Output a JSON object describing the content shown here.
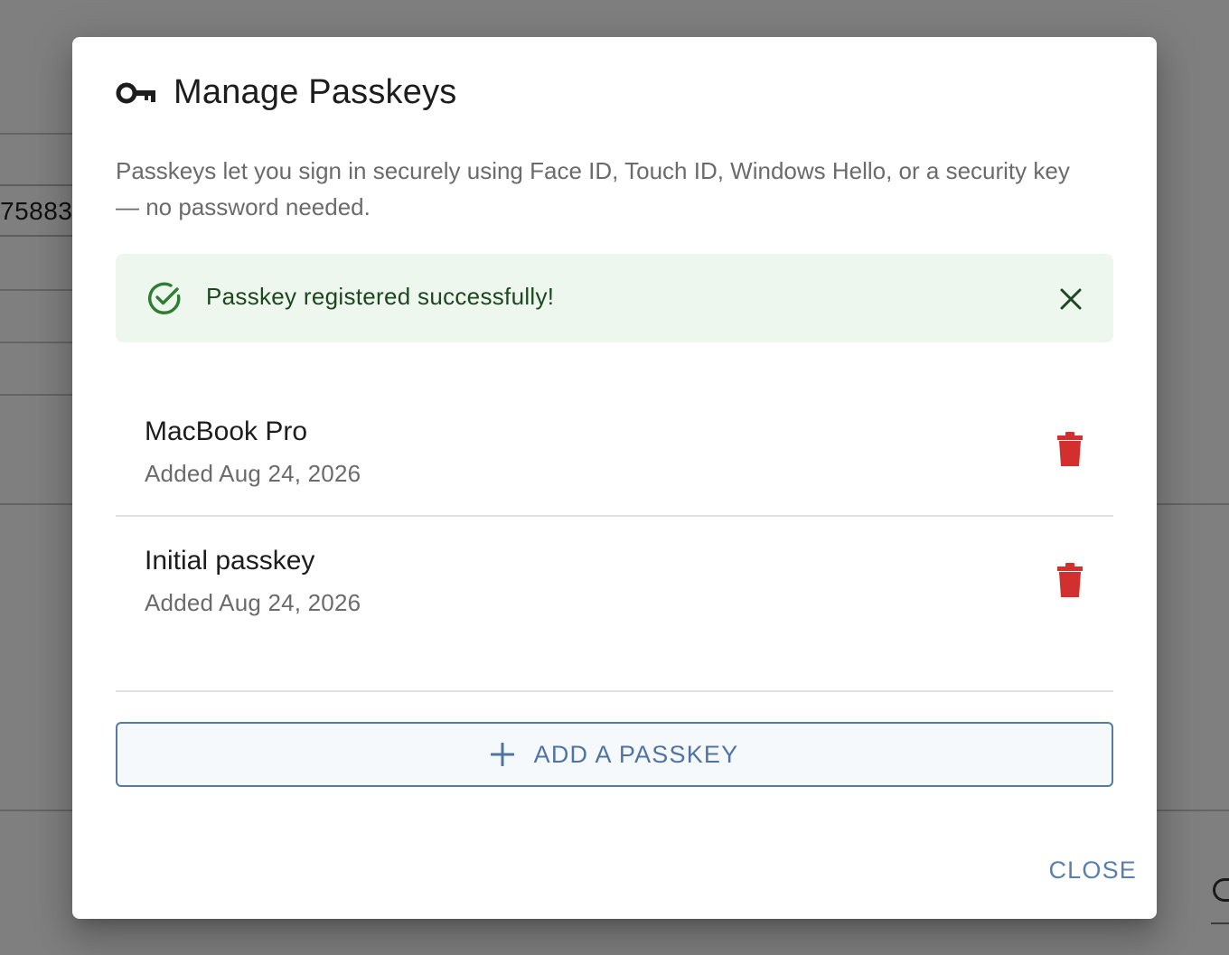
{
  "background": {
    "field_value": "75883"
  },
  "dialog": {
    "title": "Manage Passkeys",
    "title_icon": "key-icon",
    "description": "Passkeys let you sign in securely using Face ID, Touch ID, Windows Hello, or a security key — no password needed.",
    "alert": {
      "message": "Passkey registered successfully!",
      "icon": "check-circle-icon",
      "close_icon": "close-icon"
    },
    "passkeys": [
      {
        "name": "MacBook Pro",
        "added": "Added Aug 24, 2026",
        "delete_icon": "trash-icon"
      },
      {
        "name": "Initial passkey",
        "added": "Added Aug 24, 2026",
        "delete_icon": "trash-icon"
      }
    ],
    "add_button_label": "ADD A PASSKEY",
    "close_button_label": "CLOSE"
  },
  "colors": {
    "accent": "#4f74a4",
    "success_bg": "#edf7ed",
    "success_text": "#1e4620",
    "success_icon": "#2e7d32",
    "danger": "#d32f2f"
  }
}
